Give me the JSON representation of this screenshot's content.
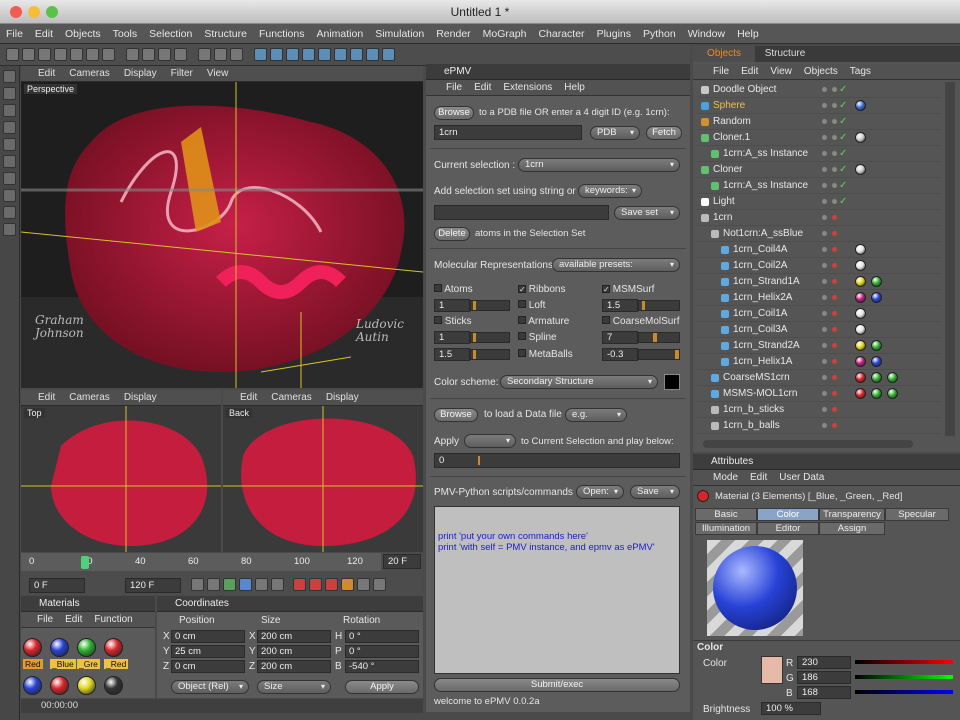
{
  "window": {
    "title": "Untitled 1 *"
  },
  "menu": [
    "File",
    "Edit",
    "Objects",
    "Tools",
    "Selection",
    "Structure",
    "Functions",
    "Animation",
    "Simulation",
    "Render",
    "MoGraph",
    "Character",
    "Plugins",
    "Python",
    "Window",
    "Help"
  ],
  "viewport_menu": [
    "Edit",
    "Cameras",
    "Display",
    "Filter",
    "View"
  ],
  "viewport_small_menu": [
    "Edit",
    "Cameras",
    "Display"
  ],
  "viewport_labels": {
    "main": "Perspective",
    "top": "Top",
    "back": "Back"
  },
  "watermarks": {
    "left": "Graham\nJohnson",
    "right": "Ludovic\nAutin"
  },
  "timeline": {
    "ticks": [
      "0",
      "20",
      "40",
      "60",
      "80",
      "100",
      "120"
    ],
    "current_frame": "20 F",
    "start": "0 F",
    "end": "120 F",
    "time": "00:00:00"
  },
  "materials": {
    "title": "Materials",
    "menu": [
      "File",
      "Edit",
      "Function"
    ],
    "swatches": [
      {
        "label": "Red",
        "color": "#d9252a"
      },
      {
        "label": "_Blue",
        "color": "#2742d6"
      },
      {
        "label": "_Gre",
        "color": "#2fb32f"
      },
      {
        "label": "_Red",
        "color": "#d9252a"
      }
    ],
    "swatches2": [
      {
        "color": "#2742d6"
      },
      {
        "color": "#d9252a"
      },
      {
        "color": "#e0d81e"
      },
      {
        "color": "#333333"
      }
    ]
  },
  "coordinates": {
    "title": "Coordinates",
    "headers": [
      "Position",
      "Size",
      "Rotation"
    ],
    "rows": [
      {
        "a": "X",
        "pos": "0 cm",
        "b": "X",
        "size": "200 cm",
        "c": "H",
        "rot": "0 °"
      },
      {
        "a": "Y",
        "pos": "25 cm",
        "b": "Y",
        "size": "200 cm",
        "c": "P",
        "rot": "0 °"
      },
      {
        "a": "Z",
        "pos": "0 cm",
        "b": "Z",
        "size": "200 cm",
        "c": "B",
        "rot": "-540 °"
      }
    ],
    "mode": "Object (Rel)",
    "size_mode": "Size",
    "apply": "Apply"
  },
  "epmv": {
    "title": "ePMV",
    "menu": [
      "File",
      "Edit",
      "Extensions",
      "Help"
    ],
    "browse": "Browse",
    "browse_hint": "to a PDB file OR enter a 4 digit ID (e.g. 1crn):",
    "pdb_id": "1crn",
    "pdb_source": "PDB",
    "fetch": "Fetch",
    "current_selection_label": "Current selection :",
    "current_selection": "1crn",
    "add_selection_label": "Add selection set using string or",
    "keywords": "keywords:",
    "save_set": "Save set",
    "delete": "Delete",
    "delete_hint": "atoms in the Selection Set",
    "mol_rep_label": "Molecular Representations",
    "presets": "available presets:",
    "reps": {
      "atoms": "Atoms",
      "ribbons": "Ribbons",
      "msmsurf": "MSMSurf",
      "loft": "Loft",
      "sticks": "Sticks",
      "armature": "Armature",
      "coarse": "CoarseMolSurf",
      "spline": "Spline",
      "metaballs": "MetaBalls"
    },
    "rep_values": {
      "atoms": "1",
      "msms": "1.5",
      "sticks1": "1",
      "sticks2": "1.5",
      "coarse1": "7",
      "coarse2": "-0.3"
    },
    "color_scheme_label": "Color scheme:",
    "color_scheme": "Secondary Structure",
    "browse2": "Browse",
    "browse2_hint": "to load a Data file",
    "eg": "e.g.",
    "apply_label": "Apply",
    "apply_hint": "to Current Selection and play below:",
    "frame_value": "0",
    "scripts_label": "PMV-Python scripts/commands",
    "open": "Open:",
    "save": "Save",
    "script_lines": [
      "print 'put your own commands here'",
      "print 'with self = PMV instance, and epmv as ePMV'"
    ],
    "submit": "Submit/exec",
    "status": "welcome to ePMV 0.0.2a"
  },
  "objects": {
    "tabs": [
      "Objects",
      "Structure"
    ],
    "menu": [
      "File",
      "Edit",
      "View",
      "Objects",
      "Tags"
    ],
    "rows": [
      {
        "name": "Doodle Object",
        "indent": 0,
        "icon": "#c8c8c8",
        "color": "#e8e8e8"
      },
      {
        "name": "Sphere",
        "indent": 0,
        "icon": "#4aa0e0",
        "color": "#f0c040"
      },
      {
        "name": "Random",
        "indent": 0,
        "icon": "#d09030",
        "color": "#e8e8e8"
      },
      {
        "name": "Cloner.1",
        "indent": 0,
        "icon": "#60c070",
        "color": "#e8e8e8"
      },
      {
        "name": "1crn:A_ss Instance",
        "indent": 1,
        "icon": "#60c070",
        "color": "#e8e8e8"
      },
      {
        "name": "Cloner",
        "indent": 0,
        "icon": "#60c070",
        "color": "#e8e8e8"
      },
      {
        "name": "1crn:A_ss Instance",
        "indent": 1,
        "icon": "#60c070",
        "color": "#e8e8e8"
      },
      {
        "name": "Light",
        "indent": 0,
        "icon": "#ffffff",
        "color": "#e8e8e8"
      },
      {
        "name": "1crn",
        "indent": 0,
        "icon": "#bbbbbb",
        "color": "#e8e8e8"
      },
      {
        "name": "Not1crn:A_ssBlue",
        "indent": 1,
        "icon": "#bbbbbb",
        "color": "#e8e8e8"
      },
      {
        "name": "1crn_Coil4A",
        "indent": 2,
        "icon": "#60a8e0",
        "color": "#e8e8e8"
      },
      {
        "name": "1crn_Coil2A",
        "indent": 2,
        "icon": "#60a8e0",
        "color": "#e8e8e8"
      },
      {
        "name": "1crn_Strand1A",
        "indent": 2,
        "icon": "#60a8e0",
        "color": "#e8e8e8"
      },
      {
        "name": "1crn_Helix2A",
        "indent": 2,
        "icon": "#60a8e0",
        "color": "#e8e8e8"
      },
      {
        "name": "1crn_Coil1A",
        "indent": 2,
        "icon": "#60a8e0",
        "color": "#e8e8e8"
      },
      {
        "name": "1crn_Coil3A",
        "indent": 2,
        "icon": "#60a8e0",
        "color": "#e8e8e8"
      },
      {
        "name": "1crn_Strand2A",
        "indent": 2,
        "icon": "#60a8e0",
        "color": "#e8e8e8"
      },
      {
        "name": "1crn_Helix1A",
        "indent": 2,
        "icon": "#60a8e0",
        "color": "#e8e8e8"
      },
      {
        "name": "CoarseMS1crn",
        "indent": 1,
        "icon": "#60a8e0",
        "color": "#e8e8e8"
      },
      {
        "name": "MSMS-MOL1crn",
        "indent": 1,
        "icon": "#60a8e0",
        "color": "#e8e8e8"
      },
      {
        "name": "1crn_b_sticks",
        "indent": 1,
        "icon": "#bbbbbb",
        "color": "#e8e8e8"
      },
      {
        "name": "1crn_b_balls",
        "indent": 1,
        "icon": "#bbbbbb",
        "color": "#e8e8e8"
      }
    ],
    "row_balls": [
      [],
      [
        "#3d6bd8"
      ],
      [],
      [
        "#cfcfcf"
      ],
      [],
      [
        "#cfcfcf"
      ],
      [],
      [],
      [],
      [],
      [
        "#e8e8e8"
      ],
      [
        "#e8e8e8"
      ],
      [
        "#e0d81e",
        "#30b030"
      ],
      [
        "#c02080",
        "#2742d6"
      ],
      [
        "#e8e8e8"
      ],
      [
        "#e8e8e8"
      ],
      [
        "#e0d81e",
        "#30b030"
      ],
      [
        "#c02080",
        "#2742d6"
      ],
      [
        "#d9252a",
        "#30b030",
        "#30b030"
      ],
      [
        "#d9252a",
        "#30b030",
        "#30b030"
      ],
      [],
      []
    ]
  },
  "attributes": {
    "title": "Attributes",
    "menu": [
      "Mode",
      "Edit",
      "User Data"
    ],
    "material": "Material (3 Elements) [_Blue, _Green, _Red]",
    "tabs_row1": [
      "Basic",
      "Color",
      "Transparency",
      "Specular"
    ],
    "tabs_row2": [
      "Illumination",
      "Editor",
      "Assign"
    ],
    "active_tab": "Color",
    "section": "Color",
    "color_label": "Color",
    "r_label": "R",
    "g_label": "G",
    "b_label": "B",
    "r": "230",
    "g": "186",
    "b": "168",
    "brightness_label": "Brightness",
    "brightness": "100 %",
    "swatch_color": "#e6baa8"
  }
}
